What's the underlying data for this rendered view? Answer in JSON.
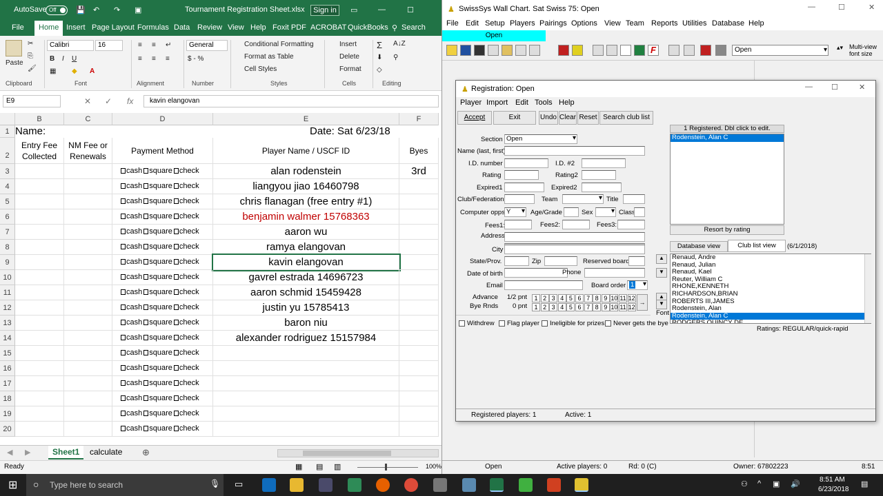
{
  "excel": {
    "autosave_label": "AutoSave",
    "autosave_state": "Off",
    "filename": "Tournament Registration Sheet.xlsx",
    "signin_label": "Sign in",
    "menu": [
      "File",
      "Home",
      "Insert",
      "Page Layout",
      "Formulas",
      "Data",
      "Review",
      "View",
      "Help",
      "Foxit PDF",
      "ACROBAT",
      "QuickBooks",
      "Search"
    ],
    "ribbon": {
      "paste": "Paste",
      "clipboard": "Clipboard",
      "font_name": "Calibri",
      "font_size": "16",
      "font_group": "Font",
      "alignment_group": "Alignment",
      "number_format": "General",
      "number_group": "Number",
      "cond_format": "Conditional Formatting",
      "format_table": "Format as Table",
      "cell_styles": "Cell Styles",
      "styles_group": "Styles",
      "insert": "Insert",
      "delete": "Delete",
      "format": "Format",
      "cells_group": "Cells",
      "editing_group": "Editing"
    },
    "name_box": "E9",
    "formula": "kavin elangovan",
    "columns": [
      "B",
      "C",
      "D",
      "E",
      "F"
    ],
    "row1_name": "Name:",
    "row1_date": "Date:  Sat 6/23/18",
    "headers": {
      "entry_fee": "Entry Fee Collected",
      "nm_fee": "NM Fee or Renewals",
      "payment": "Payment Method",
      "player": "Player Name / USCF ID",
      "byes": "Byes"
    },
    "payment_options": [
      "cash",
      "square",
      "check"
    ],
    "rows": [
      {
        "num": "1"
      },
      {
        "num": "2"
      },
      {
        "num": "3",
        "name": "alan rodenstein",
        "bye": "3rd",
        "red": false
      },
      {
        "num": "4",
        "name": "liangyou jiao 16460798",
        "bye": "",
        "red": false
      },
      {
        "num": "5",
        "name": "chris flanagan (free entry #1)",
        "bye": "",
        "red": false
      },
      {
        "num": "6",
        "name": "benjamin walmer 15768363",
        "bye": "",
        "red": true
      },
      {
        "num": "7",
        "name": "aaron wu",
        "bye": "",
        "red": false
      },
      {
        "num": "8",
        "name": "ramya elangovan",
        "bye": "",
        "red": false
      },
      {
        "num": "9",
        "name": "kavin elangovan",
        "bye": "",
        "red": false
      },
      {
        "num": "10",
        "name": "gavrel estrada 14696723",
        "bye": "",
        "red": false
      },
      {
        "num": "11",
        "name": "aaron schmid 15459428",
        "bye": "",
        "red": false
      },
      {
        "num": "12",
        "name": "justin yu 15785413",
        "bye": "",
        "red": false
      },
      {
        "num": "13",
        "name": "baron niu",
        "bye": "",
        "red": false
      },
      {
        "num": "14",
        "name": "alexander rodriguez 15157984",
        "bye": "",
        "red": false
      },
      {
        "num": "15",
        "name": "",
        "bye": "",
        "red": false
      },
      {
        "num": "16",
        "name": "",
        "bye": "",
        "red": false
      },
      {
        "num": "17",
        "name": "",
        "bye": "",
        "red": false
      },
      {
        "num": "18",
        "name": "",
        "bye": "",
        "red": false
      },
      {
        "num": "19",
        "name": "",
        "bye": "",
        "red": false
      },
      {
        "num": "20",
        "name": "",
        "bye": "",
        "red": false
      }
    ],
    "sheet_tabs": [
      "Sheet1",
      "calculate"
    ],
    "status": "Ready",
    "zoom": "100%"
  },
  "swisssys": {
    "title": "SwissSys Wall Chart. Sat Swiss 75: Open",
    "menu": [
      "File",
      "Edit",
      "Setup",
      "Players",
      "Pairings",
      "Options",
      "View",
      "Team",
      "Reports",
      "Utilities",
      "Database",
      "Help"
    ],
    "section_tab": "Open",
    "toolbar_section": "Open",
    "multiview": "Multi-view font size",
    "status": {
      "section": "Open",
      "active": "Active players: 0",
      "rd": "Rd: 0 (C)",
      "owner": "Owner: 67802223",
      "time": "8:51"
    }
  },
  "registration": {
    "title": "Registration: Open",
    "menu": [
      "Player",
      "Import",
      "Edit",
      "Tools",
      "Help"
    ],
    "buttons": {
      "accept": "Accept",
      "exit": "Exit",
      "undo": "Undo",
      "clear": "Clear",
      "reset": "Reset",
      "search": "Search club list"
    },
    "labels": {
      "section": "Section",
      "name": "Name (last, first)",
      "id": "I.D. number",
      "id2": "I.D. #2",
      "rating": "Rating",
      "rating2": "Rating2",
      "expired1": "Expired1",
      "expired2": "Expired2",
      "club": "Club/Federation",
      "team": "Team",
      "title": "Title",
      "computer": "Computer opps.",
      "age": "Age/Grade",
      "sex": "Sex",
      "class": "Class",
      "fees1": "Fees1:",
      "fees2": "Fees2:",
      "fees3": "Fees3:",
      "address": "Address",
      "city": "City",
      "state": "State/Prov.",
      "zip": "Zip",
      "reserved": "Reserved board",
      "dob": "Date of birth",
      "phone": "Phone",
      "email": "Email",
      "board_order": "Board order",
      "advance": "Advance",
      "bye_rnds": "Bye Rnds",
      "half_pnt": "1/2 pnt",
      "zero_pnt": "0 pnt",
      "font": "Font"
    },
    "values": {
      "section": "Open",
      "computer": "Y",
      "board_order": "1"
    },
    "rounds": [
      "1",
      "2",
      "3",
      "4",
      "5",
      "6",
      "7",
      "8",
      "9",
      "10",
      "11",
      "12"
    ],
    "checkboxes": [
      "Withdrew",
      "Flag player",
      "Ineligible for prizes",
      "Never gets the bye"
    ],
    "registered_header": "1 Registered. Dbl click to edit.",
    "registered_list": [
      "Rodenstein, Alan C"
    ],
    "resort": "Resort by rating",
    "db_view": "Database view",
    "club_view": "Club list view",
    "club_date": "(6/1/2018)",
    "club_list": [
      "Renaud, Andre",
      "Renaud, Julian",
      "Renaud, Kael",
      "Reuter, William C",
      "RHONE,KENNETH",
      "RICHARDSON,BRIAN",
      "ROBERTS III,JAMES",
      "Rodenstein, Alan",
      "Rodenstein, Alan C",
      "RODGERS,QUINCY DE"
    ],
    "club_selected": 8,
    "ratings": "Ratings: REGULAR/quick-rapid",
    "status_registered": "Registered players: 1",
    "status_active": "Active: 1"
  },
  "taskbar": {
    "search": "Type here to search",
    "time": "8:51 AM",
    "date": "6/23/2018"
  }
}
